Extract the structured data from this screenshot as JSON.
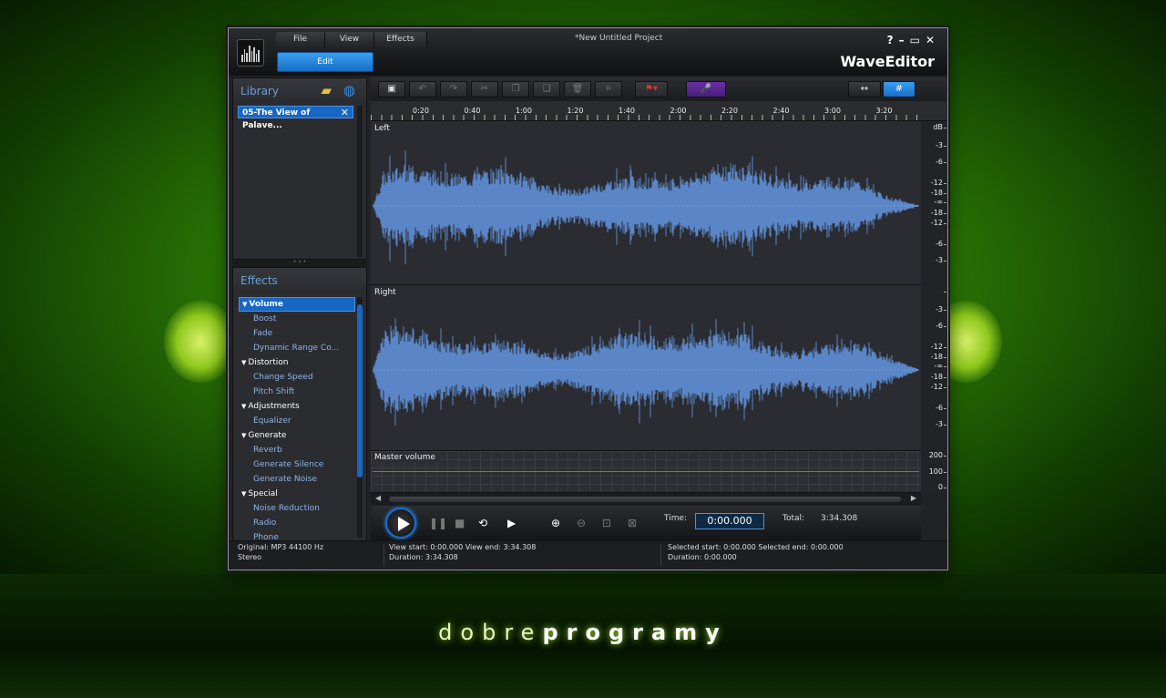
{
  "window": {
    "project_title": "*New Untitled Project",
    "app_name": "WaveEditor",
    "controls": {
      "help": "?",
      "minimize": "–",
      "maximize": "▭",
      "close": "✕"
    }
  },
  "menu": [
    "File",
    "View",
    "Effects"
  ],
  "edit_button": "Edit",
  "library": {
    "title": "Library",
    "icons": [
      "open-folder-icon",
      "globe-icon"
    ],
    "items": [
      {
        "label": "05-The View of Palave...",
        "remove": "✕"
      }
    ]
  },
  "effects": {
    "title": "Effects",
    "tree": [
      {
        "category": "Volume",
        "selected": true,
        "items": [
          "Boost",
          "Fade",
          "Dynamic Range Co..."
        ]
      },
      {
        "category": "Distortion",
        "selected": false,
        "items": [
          "Change Speed",
          "Pitch Shift"
        ]
      },
      {
        "category": "Adjustments",
        "selected": false,
        "items": [
          "Equalizer"
        ]
      },
      {
        "category": "Generate",
        "selected": false,
        "items": [
          "Reverb",
          "Generate Silence",
          "Generate Noise"
        ]
      },
      {
        "category": "Special",
        "selected": false,
        "items": [
          "Noise Reduction",
          "Radio",
          "Phone"
        ]
      }
    ]
  },
  "toolbar": [
    "save-icon",
    "undo-icon",
    "redo-icon",
    "cut-icon",
    "copy-icon",
    "paste-icon",
    "delete-icon",
    "crop-icon",
    "marker-flag-icon",
    "microphone-icon",
    "fit-view-icon",
    "grid-view-icon"
  ],
  "ruler": [
    "0:20",
    "0:40",
    "1:00",
    "1:20",
    "1:40",
    "2:00",
    "2:20",
    "2:40",
    "3:00",
    "3:20"
  ],
  "db_unit": "dB",
  "db_ticks": [
    "-3",
    "-6",
    "-12",
    "-18",
    "-∞",
    "-18",
    "-12",
    "-6",
    "-3"
  ],
  "tracks": [
    {
      "name": "Left"
    },
    {
      "name": "Right"
    }
  ],
  "master": {
    "label": "Master volume",
    "scale": [
      "200",
      "100",
      "0"
    ],
    "level": 100
  },
  "transport": {
    "time_label": "Time:",
    "time_value": "0:00.000",
    "total_label": "Total:",
    "total_value": "3:34.308"
  },
  "status": {
    "format": "Original: MP3  44100 Hz",
    "channels": "Stereo",
    "view": "View start: 0:00.000   View end: 3:34.308",
    "view_duration": "Duration: 3:34.308",
    "selection": "Selected start: 0:00.000   Selected end: 0:00.000",
    "selection_duration": "Duration: 0:00.000"
  },
  "brand": {
    "light": "dobre",
    "bold": "programy"
  },
  "colors": {
    "wave": "#5a86c8",
    "accent": "#1767c5",
    "brand_green": "#4fa60c"
  }
}
